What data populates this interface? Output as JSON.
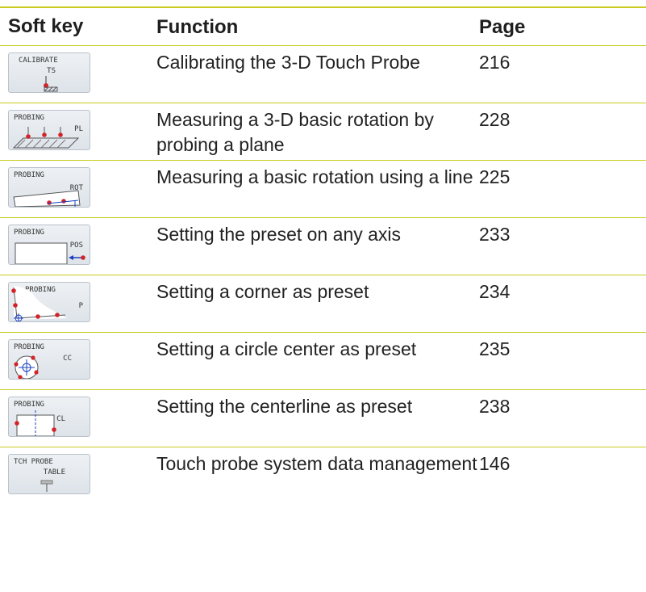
{
  "header": {
    "col1": "Soft key",
    "col2": "Function",
    "col3": "Page"
  },
  "rows": [
    {
      "key_top": "CALIBRATE",
      "key_sub": "TS",
      "function": "Calibrating the 3-D Touch Probe",
      "page": "216"
    },
    {
      "key_top": "PROBING",
      "key_sub": "PL",
      "function": "Measuring a 3-D basic rotation by probing a plane",
      "page": "228"
    },
    {
      "key_top": "PROBING",
      "key_sub": "ROT",
      "function": "Measuring a basic rotation using a line",
      "page": "225"
    },
    {
      "key_top": "PROBING",
      "key_sub": "POS",
      "function": "Setting the preset on any axis",
      "page": "233"
    },
    {
      "key_top": "PROBING",
      "key_sub": "P",
      "function": "Setting a corner as preset",
      "page": "234"
    },
    {
      "key_top": "PROBING",
      "key_sub": "CC",
      "function": "Setting a circle center as preset",
      "page": "235"
    },
    {
      "key_top": "PROBING",
      "key_sub": "CL",
      "function": "Setting the centerline as preset",
      "page": "238"
    },
    {
      "key_top": "TCH PROBE",
      "key_sub": "TABLE",
      "function": "Touch probe system data management",
      "page": "146"
    }
  ],
  "colors": {
    "rule": "#c9cc1f",
    "probe_point": "#d2232a",
    "arrow": "#1a3fbf"
  }
}
